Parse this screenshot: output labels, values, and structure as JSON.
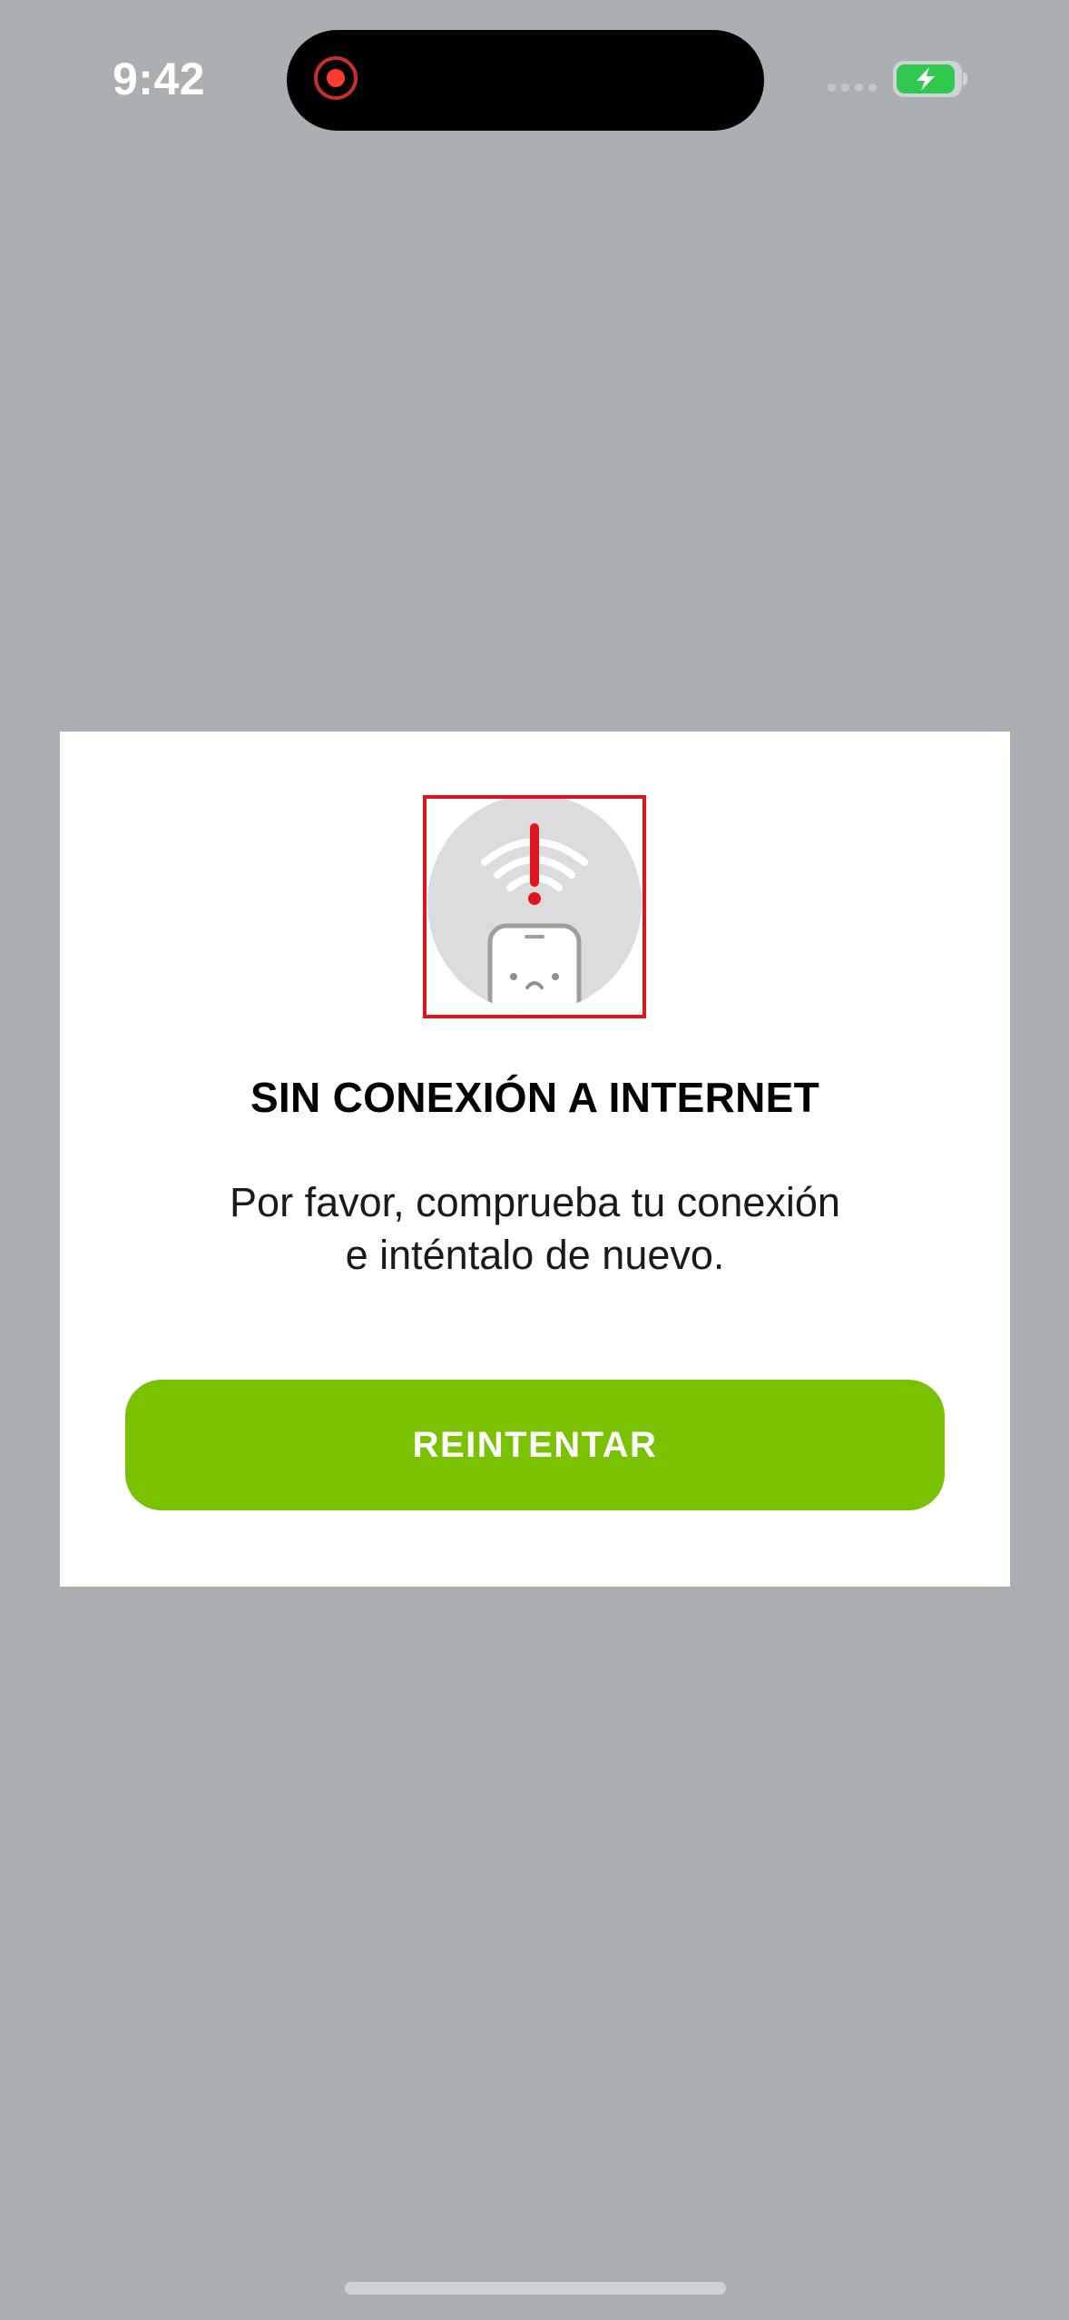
{
  "status_bar": {
    "time": "9:42",
    "icons": [
      "screen-recording-icon",
      "cellular-signal-icon",
      "battery-charging-icon"
    ]
  },
  "dialog": {
    "illustration": "no-connection-icon",
    "title": "SIN CONEXIÓN A INTERNET",
    "message_line1": "Por favor, comprueba tu conexión",
    "message_line2": "e inténtalo de nuevo.",
    "retry_label": "REINTENTAR"
  },
  "colors": {
    "backdrop": "#abafb2",
    "dialog_background": "#ffffff",
    "primary_button": "#7ac201",
    "alert_red": "#e0141e",
    "battery_green": "#31c84f"
  }
}
